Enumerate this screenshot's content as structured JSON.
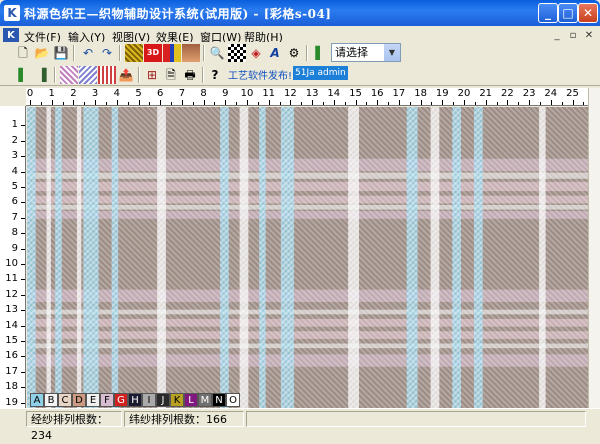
{
  "window": {
    "title": "科源色织王—织物辅助设计系统(试用版)  - [彩格s-04]",
    "icon": "K",
    "minimize": "_",
    "maximize": "□",
    "close": "✕"
  },
  "menu": {
    "items": [
      "文件(F)",
      "输入(Y)",
      "视图(V)",
      "效果(E)",
      "窗口(W)",
      "帮助(H)"
    ],
    "mdi_controls": [
      "_",
      "▫",
      "✕"
    ]
  },
  "toolbar1": {
    "icons": [
      "new-file-icon",
      "open-folder-icon",
      "save-icon",
      "undo-icon",
      "redo-icon",
      "weave-pattern-icon",
      "3d-view-icon",
      "grid-color-icon",
      "fabric-image-icon",
      "zoom-in-icon",
      "color-grid-icon",
      "paint-icon",
      "text-a-icon",
      "settings-icon",
      "book-icon"
    ],
    "select": {
      "value": "请选择"
    }
  },
  "toolbar2": {
    "icons": [
      "book-green-icon",
      "book-stack-icon",
      "pattern-a-icon",
      "pattern-b-icon",
      "pattern-c-icon",
      "export-icon",
      "view-grid-icon",
      "preview-icon",
      "print-icon",
      "help-icon"
    ],
    "marquee": "工艺软件发布!",
    "marquee_tag": "51Ja admin"
  },
  "ruler": {
    "top": [
      "0",
      "1",
      "2",
      "3",
      "4",
      "5",
      "6",
      "7",
      "8",
      "9",
      "10",
      "11",
      "12",
      "13",
      "14",
      "15",
      "16",
      "17",
      "18",
      "19",
      "20",
      "21",
      "22",
      "23",
      "24",
      "25"
    ],
    "left": [
      "1",
      "2",
      "3",
      "4",
      "5",
      "6",
      "7",
      "8",
      "9",
      "10",
      "11",
      "12",
      "13",
      "14",
      "15",
      "16",
      "17",
      "18",
      "19"
    ]
  },
  "fabric": {
    "base_color": "#9c8c84",
    "stripe_colors": {
      "A": "#8ed0e8",
      "B": "#f4f4f4",
      "C": "#d8bcd0",
      "D": "#e8c8d4"
    },
    "warp_stripes": [
      {
        "color": "A",
        "from": 0,
        "to": 0.4
      },
      {
        "color": "B",
        "from": 0.9,
        "to": 1.1
      },
      {
        "color": "A",
        "from": 1.3,
        "to": 1.6
      },
      {
        "color": "B",
        "from": 2.3,
        "to": 2.5
      },
      {
        "color": "A",
        "from": 2.6,
        "to": 3.3
      },
      {
        "color": "A",
        "from": 3.9,
        "to": 4.2
      },
      {
        "color": "B",
        "from": 6.0,
        "to": 6.4
      },
      {
        "color": "A",
        "from": 8.9,
        "to": 9.3
      },
      {
        "color": "B",
        "from": 9.8,
        "to": 10.2
      },
      {
        "color": "A",
        "from": 10.7,
        "to": 11.0
      },
      {
        "color": "A",
        "from": 11.7,
        "to": 12.3
      },
      {
        "color": "B",
        "from": 14.8,
        "to": 15.3
      },
      {
        "color": "A",
        "from": 17.5,
        "to": 18.0
      },
      {
        "color": "B",
        "from": 18.6,
        "to": 19.0
      },
      {
        "color": "A",
        "from": 19.6,
        "to": 20.0
      },
      {
        "color": "A",
        "from": 20.6,
        "to": 21.0
      },
      {
        "color": "B",
        "from": 23.6,
        "to": 23.9
      }
    ],
    "weft_stripes": [
      {
        "color": "C",
        "from": 4.1,
        "to": 4.9
      },
      {
        "color": "B",
        "from": 5.0,
        "to": 5.4
      },
      {
        "color": "D",
        "from": 5.6,
        "to": 6.2
      },
      {
        "color": "D",
        "from": 6.5,
        "to": 7.0
      },
      {
        "color": "B",
        "from": 7.1,
        "to": 7.4
      },
      {
        "color": "C",
        "from": 7.5,
        "to": 8.0
      },
      {
        "color": "C",
        "from": 12.6,
        "to": 13.4
      },
      {
        "color": "B",
        "from": 13.9,
        "to": 14.2
      },
      {
        "color": "D",
        "from": 14.5,
        "to": 15.0
      },
      {
        "color": "D",
        "from": 15.3,
        "to": 15.8
      },
      {
        "color": "B",
        "from": 16.1,
        "to": 16.4
      },
      {
        "color": "C",
        "from": 16.8,
        "to": 17.6
      }
    ]
  },
  "palette": [
    {
      "label": "A",
      "color": "#8ed0e8"
    },
    {
      "label": "B",
      "color": "#f4f4f4"
    },
    {
      "label": "C",
      "color": "#e8d4c4"
    },
    {
      "label": "D",
      "color": "#cc9a80"
    },
    {
      "label": "E",
      "color": "#f0f0f0"
    },
    {
      "label": "F",
      "color": "#d8bcd0"
    },
    {
      "label": "G",
      "color": "#d02020"
    },
    {
      "label": "H",
      "color": "#1a1a30"
    },
    {
      "label": "I",
      "color": "#aaaaaa"
    },
    {
      "label": "J",
      "color": "#2a2a2a"
    },
    {
      "label": "K",
      "color": "#b8a020"
    },
    {
      "label": "L",
      "color": "#801880"
    },
    {
      "label": "M",
      "color": "#707070"
    },
    {
      "label": "N",
      "color": "#000000"
    },
    {
      "label": "O",
      "color": "#ffffff"
    }
  ],
  "status": {
    "warp": "经纱排列根数：234",
    "weft": "纬纱排列根数：166"
  }
}
